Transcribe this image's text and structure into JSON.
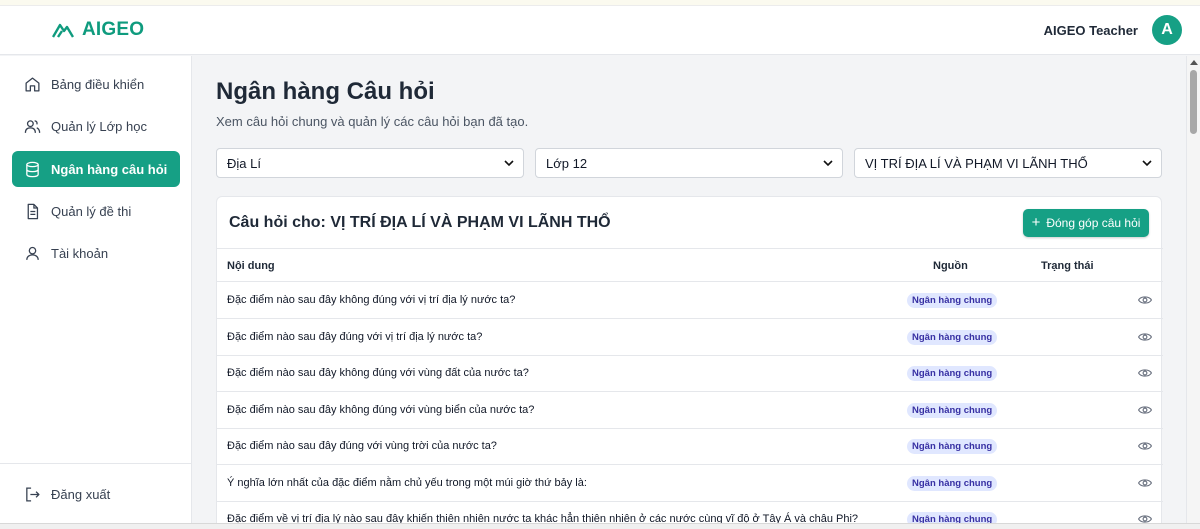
{
  "header": {
    "brand": "AIGEO",
    "user_name": "AIGEO Teacher",
    "avatar_letter": "A",
    "accent": "#16a085"
  },
  "sidebar": {
    "items": [
      {
        "label": "Bảng điều khiển",
        "icon": "home-icon"
      },
      {
        "label": "Quản lý Lớp học",
        "icon": "users-icon"
      },
      {
        "label": "Ngân hàng câu hỏi",
        "icon": "database-icon",
        "active": true
      },
      {
        "label": "Quản lý đề thi",
        "icon": "document-icon"
      },
      {
        "label": "Tài khoản",
        "icon": "user-icon"
      }
    ],
    "logout": {
      "label": "Đăng xuất",
      "icon": "logout-icon"
    }
  },
  "main": {
    "title": "Ngân hàng Câu hỏi",
    "subtitle": "Xem câu hỏi chung và quản lý các câu hỏi bạn đã tạo.",
    "filters": {
      "subject": "Địa Lí",
      "grade": "Lớp 12",
      "topic": "VỊ TRÍ ĐỊA LÍ VÀ PHẠM VI LÃNH THỔ"
    },
    "card": {
      "title": "Câu hỏi cho: VỊ TRÍ ĐỊA LÍ VÀ PHẠM VI LÃNH THỔ",
      "contribute_label": "Đóng góp câu hỏi",
      "columns": [
        "Nội dung",
        "Nguồn",
        "Trạng thái"
      ],
      "rows": [
        {
          "content": "Đặc điểm nào sau đây không đúng với vị trí địa lý nước ta?",
          "source": "Ngân hàng chung"
        },
        {
          "content": "Đặc điểm nào sau đây đúng với vị trí địa lý nước ta?",
          "source": "Ngân hàng chung"
        },
        {
          "content": "Đặc điểm nào sau đây không đúng với vùng đất của nước ta?",
          "source": "Ngân hàng chung"
        },
        {
          "content": "Đặc điểm nào sau đây không đúng với vùng biển của nước ta?",
          "source": "Ngân hàng chung"
        },
        {
          "content": "Đặc điểm nào sau đây đúng với vùng trời của nước ta?",
          "source": "Ngân hàng chung"
        },
        {
          "content": "Ý nghĩa lớn nhất của đặc điểm nằm chủ yếu trong một múi giờ thứ bảy là:",
          "source": "Ngân hàng chung"
        },
        {
          "content": "Đặc điểm về vị trí địa lý nào sau đây khiến thiên nhiên nước ta khác hẳn thiên nhiên ở các nước cùng vĩ độ ở Tây Á và châu Phi?",
          "source": "Ngân hàng chung"
        }
      ]
    }
  }
}
